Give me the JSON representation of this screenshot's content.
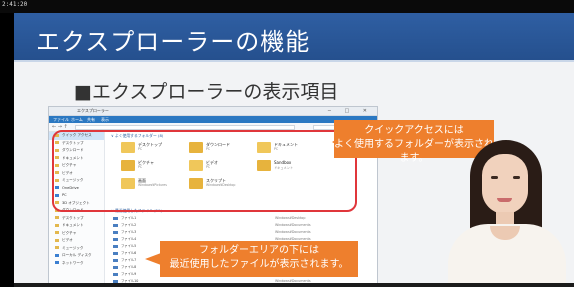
{
  "video": {
    "timecode": "2:41:20"
  },
  "slide": {
    "title": "エクスプローラーの機能",
    "subtitle": "■エクスプローラーの表示項目",
    "colors": {
      "title_bar": "#2a57a0",
      "callout": "#ee7f2d",
      "highlight_box": "#e0363b"
    }
  },
  "explorer": {
    "window_title": "エクスプローラー",
    "ribbon_tabs": [
      "ファイル",
      "ホーム",
      "共有",
      "表示"
    ],
    "address": "> クイック アクセス",
    "nav_items": [
      {
        "label": "クイック アクセス",
        "icon": "star-icon",
        "selected": true
      },
      {
        "label": "デスクトップ",
        "icon": "folder-icon"
      },
      {
        "label": "ダウンロード",
        "icon": "folder-icon"
      },
      {
        "label": "ドキュメント",
        "icon": "folder-icon"
      },
      {
        "label": "ピクチャ",
        "icon": "folder-icon"
      },
      {
        "label": "ビデオ",
        "icon": "folder-icon"
      },
      {
        "label": "ミュージック",
        "icon": "folder-icon"
      },
      {
        "label": "OneDrive",
        "icon": "cloud-icon"
      },
      {
        "label": "PC",
        "icon": "pc-icon"
      },
      {
        "label": "3D オブジェクト",
        "icon": "folder-icon"
      },
      {
        "label": "ダウンロード",
        "icon": "folder-icon"
      },
      {
        "label": "デスクトップ",
        "icon": "folder-icon"
      },
      {
        "label": "ドキュメント",
        "icon": "folder-icon"
      },
      {
        "label": "ピクチャ",
        "icon": "folder-icon"
      },
      {
        "label": "ビデオ",
        "icon": "folder-icon"
      },
      {
        "label": "ミュージック",
        "icon": "folder-icon"
      },
      {
        "label": "ローカル ディスク",
        "icon": "drive-icon"
      },
      {
        "label": "ネットワーク",
        "icon": "network-icon"
      }
    ],
    "frequent_header": "∨ よく使用するフォルダー (8)",
    "frequent_folders": [
      {
        "name": "デスクトップ",
        "sub": "PC"
      },
      {
        "name": "ダウンロード",
        "sub": "PC"
      },
      {
        "name": "ドキュメント",
        "sub": "PC"
      },
      {
        "name": "ピクチャ",
        "sub": "PC"
      },
      {
        "name": "ビデオ",
        "sub": "PC"
      },
      {
        "name": "Sandbox",
        "sub": "ドキュメント"
      },
      {
        "name": "画面",
        "sub": "Windows¥Pictures"
      },
      {
        "name": "スクリプト",
        "sub": "Windows¥Desktop"
      }
    ],
    "recent_header": "∨ 最近使用したファイル (20)",
    "recent_files": [
      {
        "name": "ファイル1",
        "location": "Windows¥Desktop"
      },
      {
        "name": "ファイル2",
        "location": "Windows¥Documents"
      },
      {
        "name": "ファイル3",
        "location": "Windows¥Documents"
      },
      {
        "name": "ファイル4",
        "location": "Windows¥Documents"
      },
      {
        "name": "ファイル5",
        "location": "Windows¥Documents"
      },
      {
        "name": "ファイル6",
        "location": "Windows¥Documents"
      },
      {
        "name": "ファイル7",
        "location": "Windows¥Documents"
      },
      {
        "name": "ファイル8",
        "location": "Windows¥Documents"
      },
      {
        "name": "ファイル9",
        "location": "Windows¥Documents"
      },
      {
        "name": "ファイル10",
        "location": "Windows¥Documents"
      }
    ]
  },
  "callouts": {
    "quick_access": [
      "クイックアクセスには",
      "よく使用するフォルダーが表示されます。"
    ],
    "recent_files": [
      "フォルダーエリアの下には",
      "最近使用したファイルが表示されます。"
    ]
  }
}
